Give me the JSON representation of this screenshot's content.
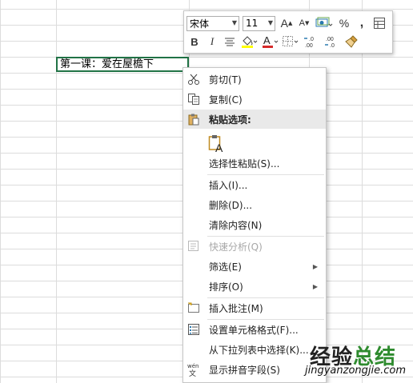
{
  "sheet": {
    "cell_text": "第一课：爱在屋檐下"
  },
  "mini_toolbar": {
    "font_name": "宋体",
    "font_size": "11",
    "percent_label": "%",
    "comma_label": ",",
    "bold_label": "B",
    "italic_label": "I",
    "font_color_label": "A",
    "increase_font_label": "A",
    "decrease_font_label": "A",
    "inc_decimal_label": "←0\n.00",
    "accent_red": "#d62b2b",
    "highlight_yellow": "#ffff00"
  },
  "context_menu": {
    "items": [
      {
        "label": "剪切(T)",
        "icon": "scissors-icon"
      },
      {
        "label": "复制(C)",
        "icon": "copy-icon"
      },
      {
        "label": "粘贴选项:",
        "icon": "clipboard-icon"
      },
      {
        "label": "选择性粘贴(S)...",
        "icon": ""
      },
      {
        "label": "插入(I)...",
        "icon": ""
      },
      {
        "label": "删除(D)...",
        "icon": ""
      },
      {
        "label": "清除内容(N)",
        "icon": ""
      },
      {
        "label": "快速分析(Q)",
        "icon": "quick-analysis-icon"
      },
      {
        "label": "筛选(E)",
        "icon": ""
      },
      {
        "label": "排序(O)",
        "icon": ""
      },
      {
        "label": "插入批注(M)",
        "icon": "comment-icon"
      },
      {
        "label": "设置单元格格式(F)...",
        "icon": "format-cells-icon"
      },
      {
        "label": "从下拉列表中选择(K)...",
        "icon": ""
      },
      {
        "label": "显示拼音字段(S)",
        "icon": "phonetic-icon"
      }
    ],
    "paste_icon_letter": "A",
    "phonetic_icon_top": "wén",
    "phonetic_icon_bottom": "文"
  },
  "watermark": {
    "title_part1": "经验",
    "title_part2": "总结",
    "url": "jingyanzongjie.com"
  }
}
